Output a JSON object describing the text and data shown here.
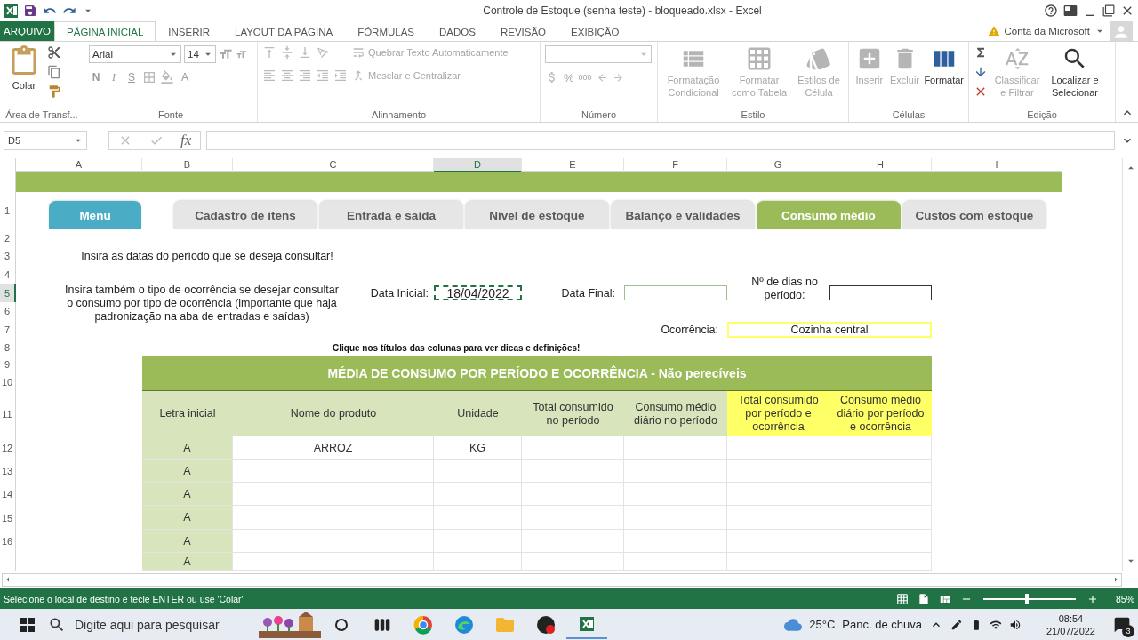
{
  "window": {
    "title": "Controle de Estoque (senha teste) - bloqueado.xlsx - Excel",
    "account": "Conta da Microsoft"
  },
  "ribbon_tabs": [
    {
      "label": "ARQUIVO",
      "kind": "file"
    },
    {
      "label": "PÁGINA INICIAL",
      "kind": "tab",
      "selected": true
    },
    {
      "label": "INSERIR",
      "kind": "tab",
      "selected": false
    },
    {
      "label": "LAYOUT DA PÁGINA",
      "kind": "tab",
      "selected": false
    },
    {
      "label": "FÓRMULAS",
      "kind": "tab",
      "selected": false
    },
    {
      "label": "DADOS",
      "kind": "tab",
      "selected": false
    },
    {
      "label": "REVISÃO",
      "kind": "tab",
      "selected": false
    },
    {
      "label": "EXIBIÇÃO",
      "kind": "tab",
      "selected": false
    }
  ],
  "ribbon": {
    "clipboard": {
      "paste": "Colar",
      "label": "Área de Transf..."
    },
    "font": {
      "name": "Arial",
      "size": "14",
      "bold": "N",
      "italic": "I",
      "underline": "S",
      "font_color": "A",
      "label": "Fonte"
    },
    "alignment": {
      "wrap": "Quebrar Texto Automaticamente",
      "merge": "Mesclar e Centralizar",
      "label": "Alinhamento"
    },
    "number": {
      "percent": "%",
      "thousands": "000",
      "label": "Número"
    },
    "styles": {
      "label": "Estilo",
      "buttons": [
        {
          "label": "Formatação Condicional",
          "kind": "conditional",
          "disabled": true
        },
        {
          "label": "Formatar como Tabela",
          "kind": "table",
          "disabled": true
        },
        {
          "label": "Estilos de Célula",
          "kind": "cellstyle",
          "disabled": true
        }
      ]
    },
    "cells": {
      "label": "Células",
      "buttons": [
        {
          "label": "Inserir",
          "kind": "insert",
          "disabled": true
        },
        {
          "label": "Excluir",
          "kind": "delete",
          "disabled": true
        },
        {
          "label": "Formatar",
          "kind": "format",
          "disabled": false
        }
      ]
    },
    "editing": {
      "label": "Edição",
      "buttons": [
        {
          "label": "Classificar e Filtrar",
          "kind": "sort",
          "disabled": true
        },
        {
          "label": "Localizar e Selecionar",
          "kind": "find",
          "disabled": false
        }
      ]
    }
  },
  "formula_bar": {
    "name_box": "D5",
    "fx": "fx"
  },
  "sheet": {
    "columns": [
      {
        "label": "A",
        "selected": false
      },
      {
        "label": "B",
        "selected": false
      },
      {
        "label": "C",
        "selected": false
      },
      {
        "label": "D",
        "selected": true
      },
      {
        "label": "E",
        "selected": false
      },
      {
        "label": "F",
        "selected": false
      },
      {
        "label": "G",
        "selected": false
      },
      {
        "label": "H",
        "selected": false
      },
      {
        "label": "I",
        "selected": false
      }
    ],
    "rows": [
      {
        "label": "1",
        "selected": false
      },
      {
        "label": "2",
        "selected": false
      },
      {
        "label": "3",
        "selected": false
      },
      {
        "label": "4",
        "selected": false
      },
      {
        "label": "5",
        "selected": true
      },
      {
        "label": "6",
        "selected": false
      },
      {
        "label": "7",
        "selected": false
      },
      {
        "label": "8",
        "selected": false
      },
      {
        "label": "9",
        "selected": false
      },
      {
        "label": "10",
        "selected": false
      },
      {
        "label": "11",
        "selected": false
      },
      {
        "label": "12",
        "selected": false
      },
      {
        "label": "13",
        "selected": false
      },
      {
        "label": "14",
        "selected": false
      },
      {
        "label": "15",
        "selected": false
      },
      {
        "label": "16",
        "selected": false
      }
    ]
  },
  "nav_tabs": [
    {
      "label": "Menu",
      "kind": "menu",
      "selected": false
    },
    {
      "label": "Cadastro de itens",
      "kind": "page",
      "selected": false
    },
    {
      "label": "Entrada e saída",
      "kind": "page",
      "selected": false
    },
    {
      "label": "Nível de estoque",
      "kind": "page",
      "selected": false
    },
    {
      "label": "Balanço e validades",
      "kind": "page",
      "selected": false
    },
    {
      "label": "Consumo médio",
      "kind": "page",
      "selected": true
    },
    {
      "label": "Custos com estoque",
      "kind": "page",
      "selected": false
    }
  ],
  "instructions": [
    "Insira as datas do período que se deseja consultar!",
    "Insira também o tipo de ocorrência se desejar consultar o consumo por tipo de ocorrência (importante que haja padronização na aba de entradas e saídas)"
  ],
  "fields": {
    "start_date": {
      "label": "Data Inicial:",
      "value": "18/04/2022",
      "copied": true
    },
    "end_date": {
      "label": "Data Final:",
      "copied": false
    },
    "days": {
      "label": "Nº de dias no período:"
    },
    "occurrence": {
      "label": "Ocorrência:",
      "value": "Cozinha central"
    }
  },
  "hint": "Clique nos títulos das colunas para ver dicas e definições!",
  "table": {
    "title": "MÉDIA DE CONSUMO POR PERÍODO E OCORRÊNCIA - Não perecíveis",
    "columns": [
      {
        "label": "Letra inicial",
        "color": "#d8e4bc"
      },
      {
        "label": "Nome do produto",
        "color": "#d8e4bc"
      },
      {
        "label": "Unidade",
        "color": "#d8e4bc"
      },
      {
        "label": "Total consumido no período",
        "color": "#d8e4bc"
      },
      {
        "label": "Consumo médio diário no período",
        "color": "#d8e4bc"
      },
      {
        "label": "Total consumido por período e ocorrência",
        "color": "#ffff66"
      },
      {
        "label": "Consumo médio diário por período e ocorrência",
        "color": "#ffff66"
      }
    ],
    "rows": [
      {
        "letter": "A",
        "product": "ARROZ",
        "unit": "KG"
      },
      {
        "letter": "A"
      },
      {
        "letter": "A"
      },
      {
        "letter": "A"
      },
      {
        "letter": "A"
      },
      {
        "letter": "A"
      }
    ]
  },
  "status_bar": {
    "message": "Selecione o local de destino e tecle ENTER ou use 'Colar'",
    "zoom": {
      "level": 0.47,
      "reading": "85%"
    }
  },
  "taskbar": {
    "search_placeholder": "Digite aqui para pesquisar",
    "weather": {
      "temperature": "25°C",
      "condition": "Panc. de chuva"
    },
    "time": "08:54",
    "date": "21/07/2022",
    "notifications": "3"
  }
}
